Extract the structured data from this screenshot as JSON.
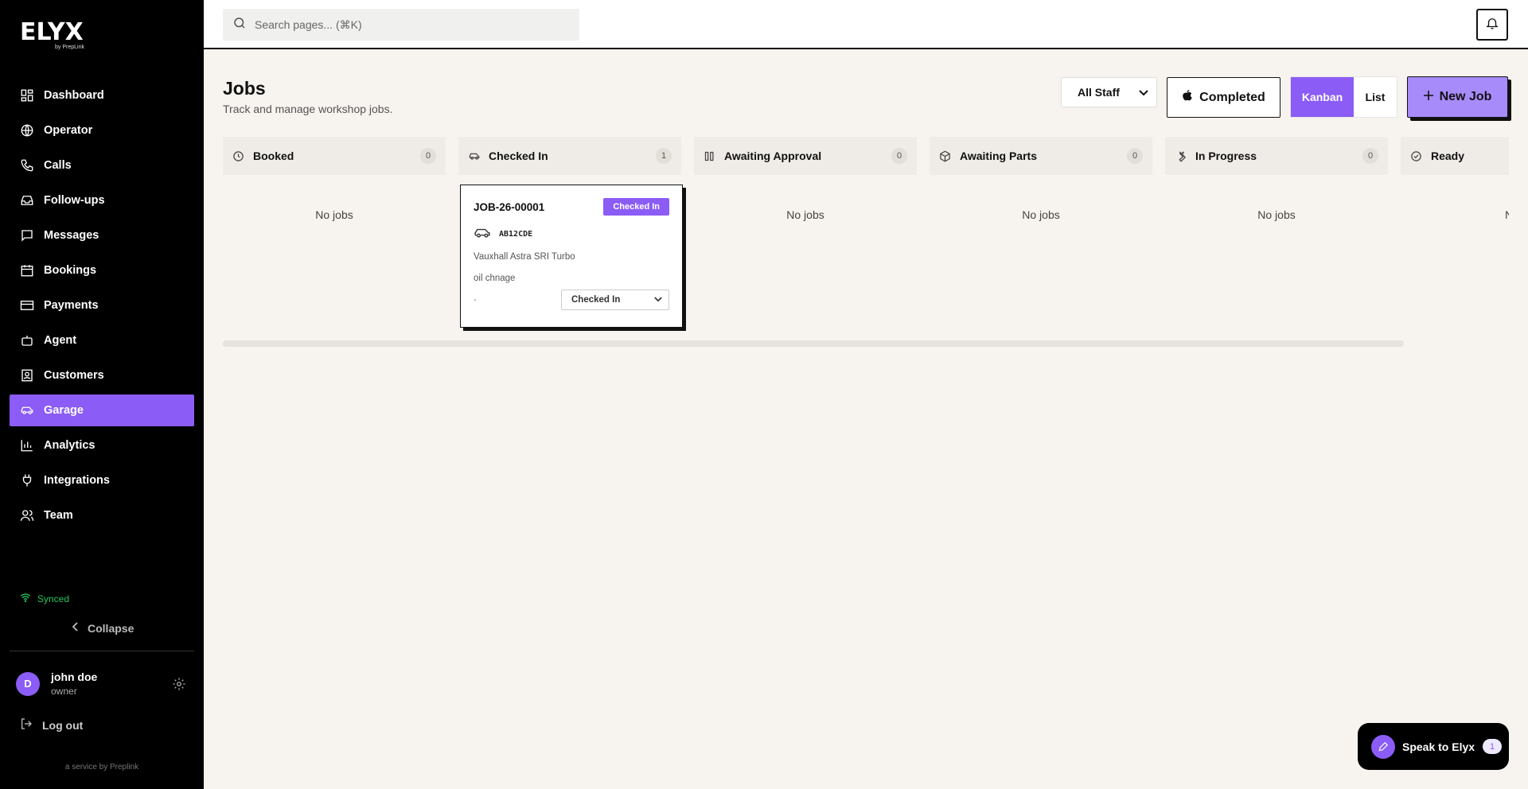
{
  "brand": {
    "name": "ELYX",
    "sub": "by PrepLink"
  },
  "sidebar": {
    "items": [
      {
        "label": "Dashboard",
        "icon": "grid-icon"
      },
      {
        "label": "Operator",
        "icon": "globe-icon"
      },
      {
        "label": "Calls",
        "icon": "phone-icon"
      },
      {
        "label": "Follow-ups",
        "icon": "inbox-icon"
      },
      {
        "label": "Messages",
        "icon": "message-icon"
      },
      {
        "label": "Bookings",
        "icon": "calendar-icon"
      },
      {
        "label": "Payments",
        "icon": "credit-card-icon"
      },
      {
        "label": "Agent",
        "icon": "bot-icon"
      },
      {
        "label": "Customers",
        "icon": "contact-icon"
      },
      {
        "label": "Garage",
        "icon": "car-icon",
        "active": true
      },
      {
        "label": "Analytics",
        "icon": "chart-icon"
      },
      {
        "label": "Integrations",
        "icon": "plug-icon"
      },
      {
        "label": "Team",
        "icon": "users-icon"
      }
    ],
    "synced": "Synced",
    "collapse": "Collapse",
    "user": {
      "initial": "D",
      "name": "john doe",
      "role": "owner"
    },
    "logout": "Log out",
    "service": "a service by Preplink"
  },
  "search": {
    "placeholder": "Search pages... (⌘K)"
  },
  "page": {
    "title": "Jobs",
    "subtitle": "Track and manage workshop jobs.",
    "staff_filter": "All Staff",
    "completed": "Completed",
    "view_kanban": "Kanban",
    "view_list": "List",
    "new_job": "New Job"
  },
  "columns": [
    {
      "label": "Booked",
      "count": "0",
      "icon": "clock-icon",
      "empty": "No jobs"
    },
    {
      "label": "Checked In",
      "count": "1",
      "icon": "car-icon",
      "empty": ""
    },
    {
      "label": "Awaiting Approval",
      "count": "0",
      "icon": "columns-icon",
      "empty": "No jobs"
    },
    {
      "label": "Awaiting Parts",
      "count": "0",
      "icon": "package-icon",
      "empty": "No jobs"
    },
    {
      "label": "In Progress",
      "count": "0",
      "icon": "wrench-icon",
      "empty": "No jobs"
    },
    {
      "label": "Ready",
      "count": "",
      "icon": "check-circle-icon",
      "empty": "No"
    }
  ],
  "card": {
    "job_number": "JOB-26-00001",
    "status": "Checked In",
    "reg": "AB12CDE",
    "vehicle": "Vauxhall Astra SRI Turbo",
    "description": "oil chnage",
    "assignee": "-",
    "status_select": "Checked In"
  },
  "assistant": {
    "label": "Speak to Elyx",
    "badge": "1"
  },
  "colors": {
    "accent": "#8b5cf6",
    "sidebar": "#000000",
    "background": "#f7f3ee",
    "synced": "#22c55e"
  }
}
